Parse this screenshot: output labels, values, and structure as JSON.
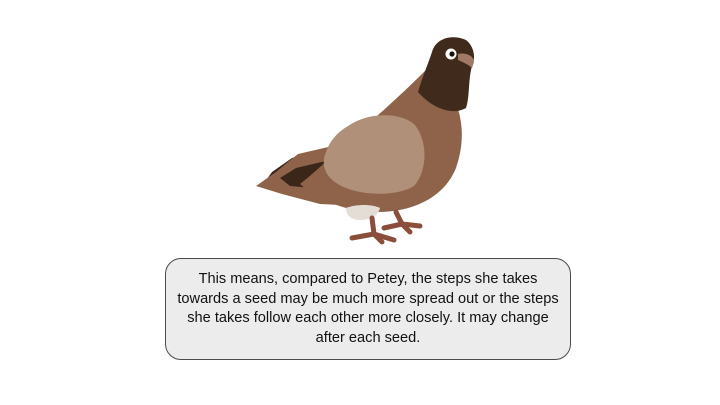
{
  "slide": {
    "caption": "This means, compared to Petey, the steps she takes towards a seed may be much more spread out or the steps she takes follow each other more closely. It may change after each seed."
  },
  "illustration": {
    "subject": "pigeon",
    "icon": "pigeon-icon"
  },
  "colors": {
    "head": "#3f2a1b",
    "body": "#8f634a",
    "wing": "#b09078",
    "tail_dark": "#3a2719",
    "feet": "#8a4e3a",
    "beak": "#a17a66",
    "caption_fill": "#ececec",
    "caption_border": "#4a4a4a"
  }
}
